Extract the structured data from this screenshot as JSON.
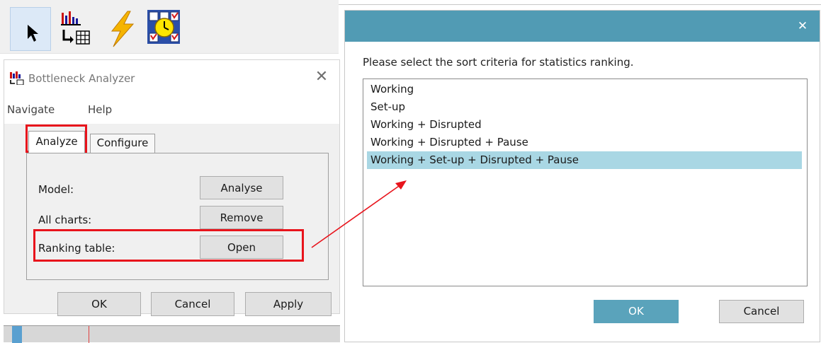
{
  "toolbar": {
    "tools": [
      {
        "icon": "pointer-arrow-icon"
      },
      {
        "icon": "chart-to-table-icon"
      },
      {
        "icon": "lightning-icon"
      },
      {
        "icon": "clock-grid-icon"
      }
    ]
  },
  "bottleneck_analyzer": {
    "title": "Bottleneck Analyzer",
    "close_glyph": "✕",
    "menu": [
      "Navigate",
      "Help"
    ],
    "tabs": [
      "Analyze",
      "Configure"
    ],
    "rows": [
      {
        "label": "Model:",
        "button": "Analyse"
      },
      {
        "label": "All charts:",
        "button": "Remove"
      },
      {
        "label": "Ranking table:",
        "button": "Open"
      }
    ],
    "footer_buttons": {
      "ok": "OK",
      "cancel": "Cancel",
      "apply": "Apply"
    }
  },
  "sort_dialog": {
    "close_glyph": "✕",
    "prompt": "Please select the sort criteria for statistics ranking.",
    "options": [
      "Working",
      "Set-up",
      "Working + Disrupted",
      "Working + Disrupted + Pause",
      "Working + Set-up + Disrupted + Pause"
    ],
    "selected_index": 4,
    "buttons": {
      "ok": "OK",
      "cancel": "Cancel"
    }
  },
  "colors": {
    "highlight": "#e8141c",
    "titlebar": "#519bb4",
    "selection": "#a9d7e4"
  }
}
